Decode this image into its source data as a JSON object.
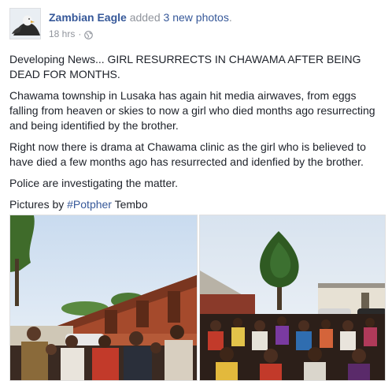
{
  "post": {
    "author": "Zambian Eagle",
    "action_text": "added",
    "action_link": "3 new photos",
    "action_suffix": ".",
    "timestamp": "18 hrs",
    "separator": "·",
    "privacy_icon": "globe-icon"
  },
  "body": {
    "paragraph_1": "Developing News... GIRL RESURRECTS IN CHAWAMA AFTER BEING DEAD FOR MONTHS.",
    "paragraph_2": "Chawama township in Lusaka has again hit media airwaves, from eggs falling from heaven or skies to now a girl who died months ago resurrecting and being identified by the brother.",
    "paragraph_3": "Right now there is drama at Chawama clinic as the girl who is believed to have died a few months ago has resurrected and idenfied by the brother.",
    "paragraph_4": "Police are investigating the matter.",
    "credit_prefix": "Pictures by",
    "credit_hashtag": "#Potpher",
    "credit_suffix": "Tembo"
  },
  "colors": {
    "link": "#365899",
    "meta": "#90949c",
    "text": "#1d2129"
  }
}
